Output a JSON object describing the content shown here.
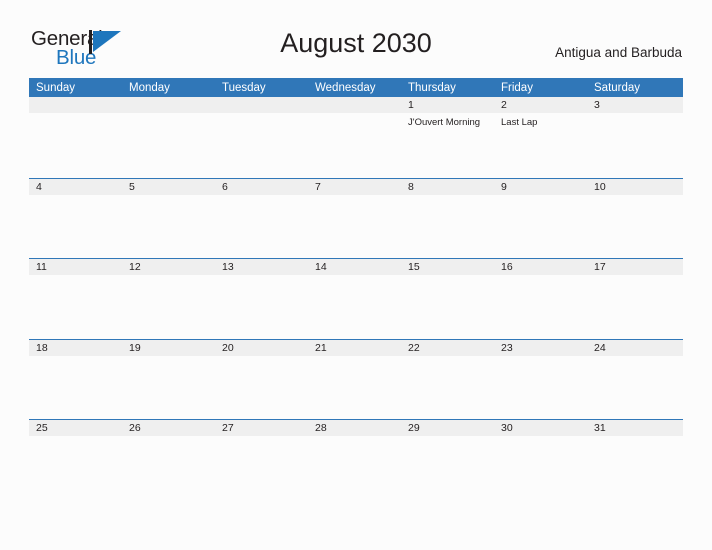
{
  "brand": {
    "name_part1": "General",
    "name_part2": "Blue",
    "accent_color": "#1e76bd"
  },
  "header": {
    "month_title": "August 2030",
    "country": "Antigua and Barbuda",
    "header_bg_color": "#3077b8",
    "date_band_color": "#efefef"
  },
  "calendar": {
    "weekdays": [
      "Sunday",
      "Monday",
      "Tuesday",
      "Wednesday",
      "Thursday",
      "Friday",
      "Saturday"
    ],
    "weeks": [
      {
        "days": [
          {
            "date": "",
            "events": ""
          },
          {
            "date": "",
            "events": ""
          },
          {
            "date": "",
            "events": ""
          },
          {
            "date": "",
            "events": ""
          },
          {
            "date": "1",
            "events": "J'Ouvert Morning"
          },
          {
            "date": "2",
            "events": "Last Lap"
          },
          {
            "date": "3",
            "events": ""
          }
        ]
      },
      {
        "days": [
          {
            "date": "4",
            "events": ""
          },
          {
            "date": "5",
            "events": ""
          },
          {
            "date": "6",
            "events": ""
          },
          {
            "date": "7",
            "events": ""
          },
          {
            "date": "8",
            "events": ""
          },
          {
            "date": "9",
            "events": ""
          },
          {
            "date": "10",
            "events": ""
          }
        ]
      },
      {
        "days": [
          {
            "date": "11",
            "events": ""
          },
          {
            "date": "12",
            "events": ""
          },
          {
            "date": "13",
            "events": ""
          },
          {
            "date": "14",
            "events": ""
          },
          {
            "date": "15",
            "events": ""
          },
          {
            "date": "16",
            "events": ""
          },
          {
            "date": "17",
            "events": ""
          }
        ]
      },
      {
        "days": [
          {
            "date": "18",
            "events": ""
          },
          {
            "date": "19",
            "events": ""
          },
          {
            "date": "20",
            "events": ""
          },
          {
            "date": "21",
            "events": ""
          },
          {
            "date": "22",
            "events": ""
          },
          {
            "date": "23",
            "events": ""
          },
          {
            "date": "24",
            "events": ""
          }
        ]
      },
      {
        "days": [
          {
            "date": "25",
            "events": ""
          },
          {
            "date": "26",
            "events": ""
          },
          {
            "date": "27",
            "events": ""
          },
          {
            "date": "28",
            "events": ""
          },
          {
            "date": "29",
            "events": ""
          },
          {
            "date": "30",
            "events": ""
          },
          {
            "date": "31",
            "events": ""
          }
        ]
      }
    ]
  }
}
